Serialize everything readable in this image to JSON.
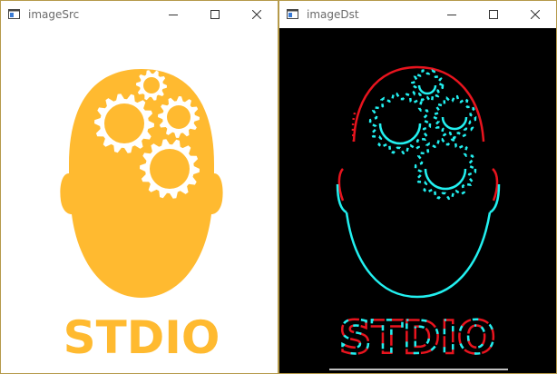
{
  "windows": [
    {
      "title": "imageSrc",
      "controls": [
        "minimize-icon",
        "maximize-icon",
        "close-icon"
      ],
      "image": {
        "logo_text": "STDIO",
        "colors": {
          "logo": "#FFBA30",
          "background": "#FFFFFF",
          "gears": "#FFFFFF"
        }
      }
    },
    {
      "title": "imageDst",
      "controls": [
        "minimize-icon",
        "maximize-icon",
        "close-icon"
      ],
      "image": {
        "logo_text": "STDIO",
        "colors": {
          "edge_cyan": "#22F0F0",
          "edge_red": "#E8141E",
          "background": "#000000"
        }
      }
    }
  ]
}
